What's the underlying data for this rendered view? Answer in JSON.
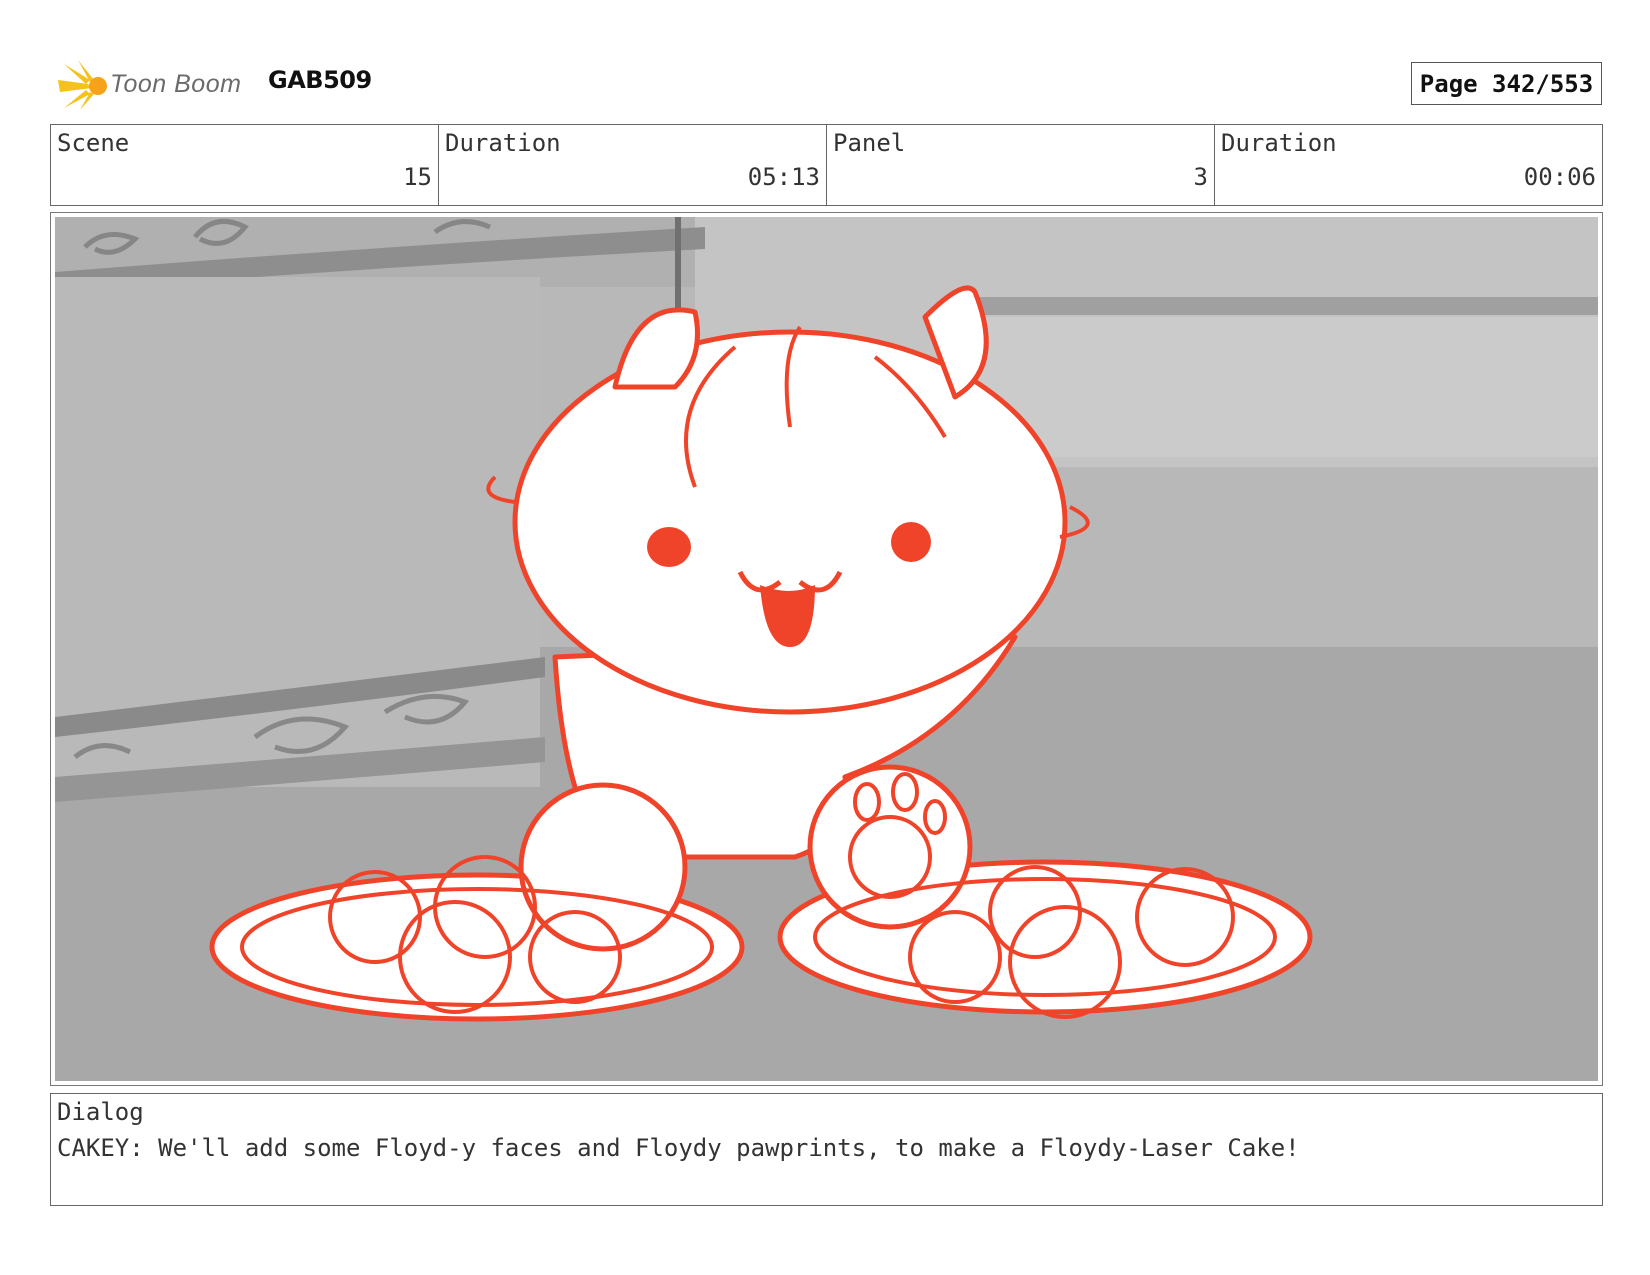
{
  "header": {
    "brand": "Toon Boom",
    "project_code": "GAB509",
    "page_label": "Page 342/553"
  },
  "info": {
    "scene_label": "Scene",
    "scene_value": "15",
    "scene_duration_label": "Duration",
    "scene_duration_value": "05:13",
    "panel_label": "Panel",
    "panel_value": "3",
    "panel_duration_label": "Duration",
    "panel_duration_value": "00:06"
  },
  "dialog": {
    "label": "Dialog",
    "text": "CAKEY: We'll add some Floyd-y faces and Floydy pawprints, to make a Floydy-Laser Cake!"
  },
  "colors": {
    "sketch_red": "#f0442a",
    "background_gray": "#b3b3b3"
  }
}
